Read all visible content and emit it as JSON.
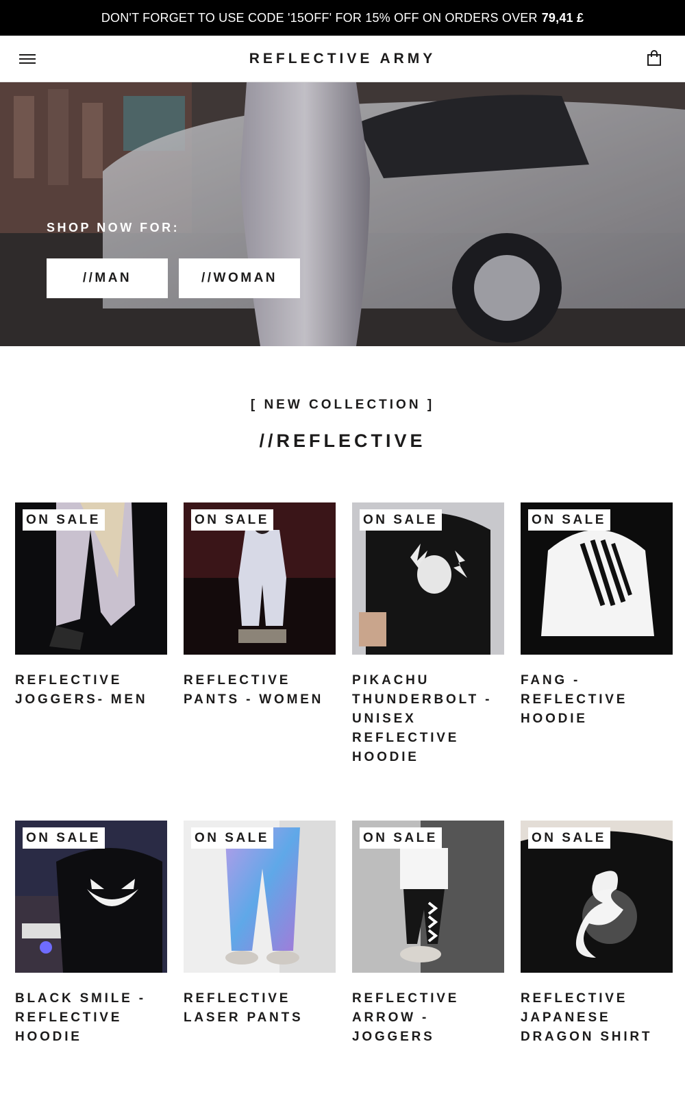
{
  "announcement": {
    "text": "DON'T FORGET TO USE CODE '15OFF' FOR 15% OFF ON ORDERS OVER",
    "amount": "79,41 £"
  },
  "header": {
    "logo": "REFLECTIVE ARMY",
    "menu_icon": "hamburger-icon",
    "cart_icon": "shopping-bag-icon"
  },
  "hero": {
    "shop_label": "SHOP NOW FOR:",
    "buttons": [
      {
        "label": "//MAN"
      },
      {
        "label": "//WOMAN"
      }
    ]
  },
  "collection": {
    "subtitle": "[ NEW COLLECTION ]",
    "title": "//REFLECTIVE"
  },
  "products": [
    {
      "title": "REFLECTIVE JOGGERS- MEN",
      "badge": "ON SALE"
    },
    {
      "title": "REFLECTIVE PANTS - WOMEN",
      "badge": "ON SALE"
    },
    {
      "title": "PIKACHU THUNDERBOLT - UNISEX REFLECTIVE HOODIE",
      "badge": "ON SALE"
    },
    {
      "title": "FANG - REFLECTIVE HOODIE",
      "badge": "ON SALE"
    },
    {
      "title": "BLACK SMILE - REFLECTIVE HOODIE",
      "badge": "ON SALE"
    },
    {
      "title": "REFLECTIVE LASER PANTS",
      "badge": "ON SALE"
    },
    {
      "title": "REFLECTIVE ARROW - JOGGERS",
      "badge": "ON SALE"
    },
    {
      "title": "REFLECTIVE JAPANESE DRAGON SHIRT",
      "badge": "ON SALE"
    }
  ],
  "colors": {
    "announcement_bg": "#000000",
    "text": "#1c1b1b",
    "background": "#ffffff"
  }
}
